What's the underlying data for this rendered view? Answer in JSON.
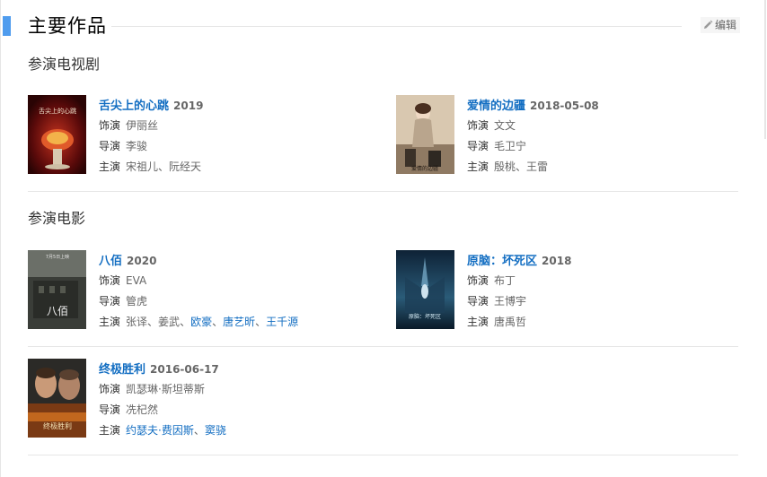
{
  "section": {
    "title": "主要作品",
    "edit_label": "编辑"
  },
  "tv": {
    "heading": "参演电视剧",
    "works": [
      {
        "title": "舌尖上的心跳",
        "year": "2019",
        "role_label": "饰演",
        "role": "伊丽丝",
        "director_label": "导演",
        "director": "李骏",
        "cast_label": "主演",
        "cast_1": "宋祖儿",
        "sep_1": "、",
        "cast_2": "阮经天",
        "poster_text": "舌尖上的心跳"
      },
      {
        "title": "爱情的边疆",
        "year": "2018-05-08",
        "role_label": "饰演",
        "role": "文文",
        "director_label": "导演",
        "director": "毛卫宁",
        "cast_label": "主演",
        "cast_1": "殷桃",
        "sep_1": "、",
        "cast_2": "王雷",
        "poster_text": "爱情的边疆"
      }
    ]
  },
  "movie": {
    "heading": "参演电影",
    "works": [
      {
        "title": "八佰",
        "year": "2020",
        "role_label": "饰演",
        "role": "EVA",
        "director_label": "导演",
        "director": "管虎",
        "cast_label": "主演",
        "cast_1": "张译",
        "sep_1": "、",
        "cast_2": "姜武",
        "sep_2": "、",
        "cast_3": "欧豪",
        "sep_3": "、",
        "cast_4": "唐艺昕",
        "sep_4": "、",
        "cast_5": "王千源",
        "poster_text": "八佰",
        "poster_date": "7月5日上映"
      },
      {
        "title": "原脑：坏死区",
        "year": "2018",
        "role_label": "饰演",
        "role": "布丁",
        "director_label": "导演",
        "director": "王博宇",
        "cast_label": "主演",
        "cast_1": "唐禹哲",
        "poster_text": "原脑：坏死区"
      },
      {
        "title": "终极胜利",
        "year": "2016-06-17",
        "role_label": "饰演",
        "role": "凯瑟琳·斯坦蒂斯",
        "director_label": "导演",
        "director": "冼杞然",
        "cast_label": "主演",
        "cast_1": "约瑟夫·费因斯",
        "sep_1": "、",
        "cast_2": "窦骁",
        "poster_text": "终极胜利"
      }
    ]
  },
  "colors": {
    "accent": "#4f9cee",
    "link": "#136ec2",
    "muted": "#666666"
  }
}
